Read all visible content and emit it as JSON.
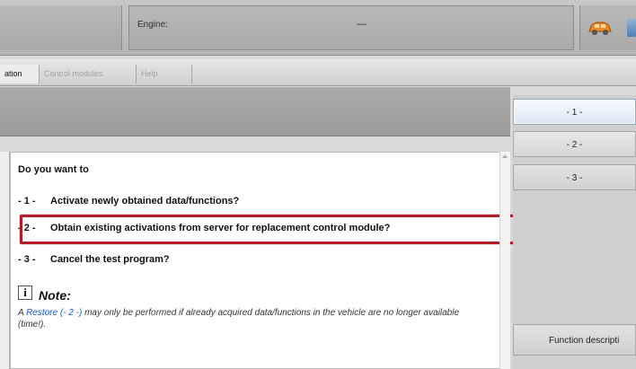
{
  "header": {
    "engine_label": "Engine:",
    "engine_value": "—"
  },
  "tabs": [
    {
      "label": "ation"
    },
    {
      "label": "Control modules"
    },
    {
      "label": "Help"
    }
  ],
  "dialog": {
    "prompt": "Do you want to",
    "options": [
      {
        "number": "- 1 -",
        "text": "Activate newly obtained data/functions?"
      },
      {
        "number": "- 2 -",
        "text": "Obtain existing activations from server for replacement control module?"
      },
      {
        "number": "- 3 -",
        "text": "Cancel the test program?"
      }
    ],
    "note": {
      "icon": "i",
      "heading": "Note:",
      "text_prefix": "A ",
      "link_text": "Restore (- 2 -)",
      "text_suffix": " may only be performed if already acquired data/functions in the vehicle are no longer available (time!)."
    }
  },
  "side_buttons": [
    {
      "label": "- 1 -"
    },
    {
      "label": "- 2 -"
    },
    {
      "label": "- 3 -"
    }
  ],
  "function_button": "Function descripti",
  "colors": {
    "highlight": "#b31d2a",
    "link": "#1a56d6"
  }
}
